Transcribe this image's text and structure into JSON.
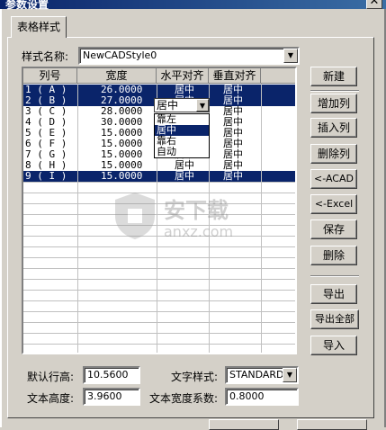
{
  "window": {
    "title": "参数设置",
    "close_glyph": "✕"
  },
  "tab": {
    "label": "表格样式"
  },
  "style_name": {
    "label": "样式名称:",
    "value": "NewCADStyle0"
  },
  "grid": {
    "headers": [
      "列号",
      "宽度",
      "水平对齐",
      "垂直对齐"
    ],
    "rows": [
      {
        "num": "1 ( A )",
        "width": "26.0000",
        "h_align": "居中",
        "v_align": "居中",
        "selected": true
      },
      {
        "num": "2 ( B )",
        "width": "27.0000",
        "h_align": "居中",
        "v_align": "居中",
        "selected": true
      },
      {
        "num": "3 ( C )",
        "width": "28.0000",
        "h_align": "",
        "v_align": "居中",
        "selected": false
      },
      {
        "num": "4 ( D )",
        "width": "30.0000",
        "h_align": "",
        "v_align": "居中",
        "selected": false
      },
      {
        "num": "5 ( E )",
        "width": "15.0000",
        "h_align": "",
        "v_align": "居中",
        "selected": false
      },
      {
        "num": "6 ( F )",
        "width": "15.0000",
        "h_align": "",
        "v_align": "居中",
        "selected": false
      },
      {
        "num": "7 ( G )",
        "width": "15.0000",
        "h_align": "居中",
        "v_align": "居中",
        "selected": false
      },
      {
        "num": "8 ( H )",
        "width": "15.0000",
        "h_align": "居中",
        "v_align": "居中",
        "selected": false
      },
      {
        "num": "9 ( I )",
        "width": "15.0000",
        "h_align": "居中",
        "v_align": "居中",
        "selected": true
      }
    ],
    "dropdown": {
      "value": "居中",
      "options": [
        "靠左",
        "居中",
        "靠右",
        "自动"
      ],
      "highlighted": "居中"
    }
  },
  "buttons": {
    "new": "新建",
    "add_col": "增加列",
    "insert_col": "插入列",
    "delete_col": "删除列",
    "to_acad": "<-ACAD",
    "to_excel": "<-Excel",
    "save": "保存",
    "delete": "删除",
    "export": "导出",
    "export_all": "导出全部",
    "import": "导入"
  },
  "settings": {
    "default_row_height": {
      "label": "默认行高:",
      "value": "10.5600"
    },
    "text_style": {
      "label": "文字样式:",
      "value": "STANDARD"
    },
    "text_height": {
      "label": "文本高度:",
      "value": "3.9600"
    },
    "text_width_factor": {
      "label": "文本宽度系数:",
      "value": "0.8000"
    }
  },
  "watermark": {
    "text": "安下载",
    "subtext": "anxz.com"
  },
  "colors": {
    "selection": "#0a246a",
    "face": "#d4d0c8"
  }
}
